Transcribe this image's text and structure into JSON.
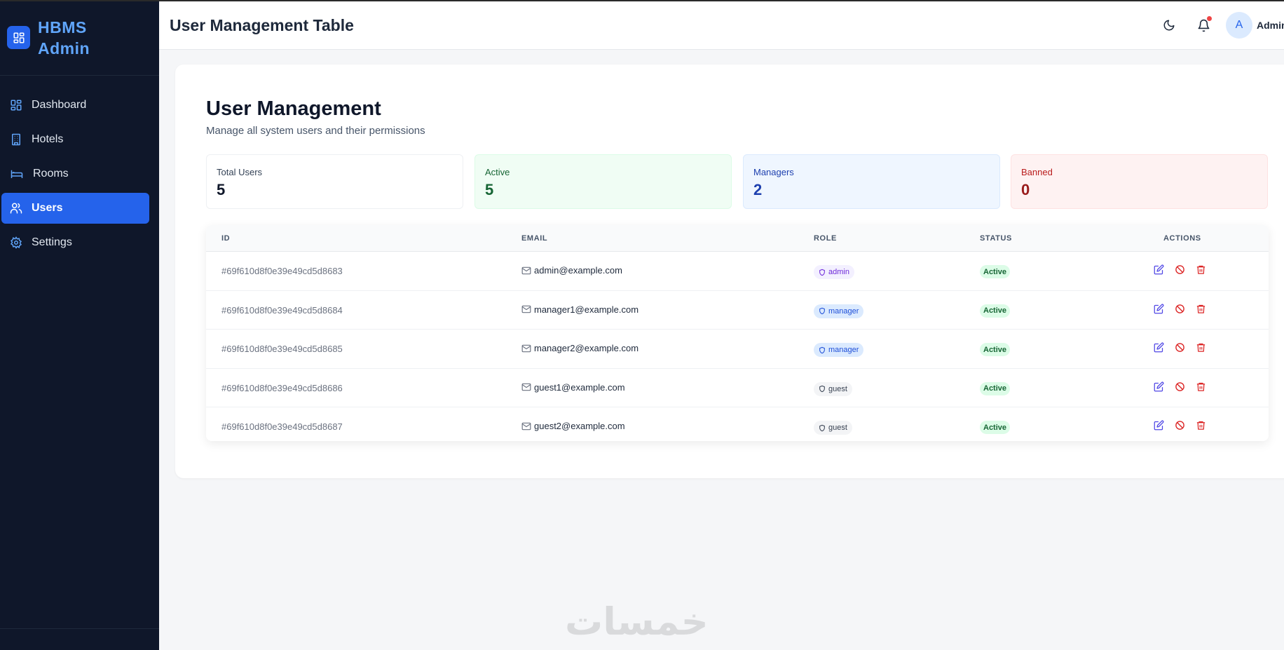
{
  "brand": {
    "line1": "HBMS",
    "line2": "Admin",
    "icon": "grid-icon",
    "color": "#2563eb"
  },
  "sidebar": {
    "items": [
      {
        "label": "Dashboard",
        "icon": "dashboard-icon",
        "active": false
      },
      {
        "label": "Hotels",
        "icon": "building-icon",
        "active": false
      },
      {
        "label": "Rooms",
        "icon": "bed-icon",
        "active": false
      },
      {
        "label": "Users",
        "icon": "users-icon",
        "active": true
      },
      {
        "label": "Settings",
        "icon": "gear-icon",
        "active": false
      }
    ]
  },
  "header": {
    "title": "User Management Table",
    "theme_icon": "moon-icon",
    "notification_icon": "bell-icon",
    "avatar_initial": "A",
    "user_name": "Admin"
  },
  "page": {
    "title": "User Management",
    "subtitle": "Manage all system users and their permissions"
  },
  "stats": {
    "total": {
      "label": "Total Users",
      "value": "5"
    },
    "active": {
      "label": "Active",
      "value": "5"
    },
    "managers": {
      "label": "Managers",
      "value": "2"
    },
    "banned": {
      "label": "Banned",
      "value": "0"
    }
  },
  "table": {
    "columns": [
      "ID",
      "EMAIL",
      "ROLE",
      "STATUS",
      "ACTIONS"
    ],
    "rows": [
      {
        "id": "#69f610d8f0e39e49cd5d8683",
        "email": "admin@example.com",
        "role": "admin",
        "status": "Active"
      },
      {
        "id": "#69f610d8f0e39e49cd5d8684",
        "email": "manager1@example.com",
        "role": "manager",
        "status": "Active"
      },
      {
        "id": "#69f610d8f0e39e49cd5d8685",
        "email": "manager2@example.com",
        "role": "manager",
        "status": "Active"
      },
      {
        "id": "#69f610d8f0e39e49cd5d8686",
        "email": "guest1@example.com",
        "role": "guest",
        "status": "Active"
      },
      {
        "id": "#69f610d8f0e39e49cd5d8687",
        "email": "guest2@example.com",
        "role": "guest",
        "status": "Active"
      }
    ],
    "action_icons": [
      "edit-icon",
      "ban-icon",
      "trash-icon"
    ]
  },
  "watermark": "خمسات"
}
